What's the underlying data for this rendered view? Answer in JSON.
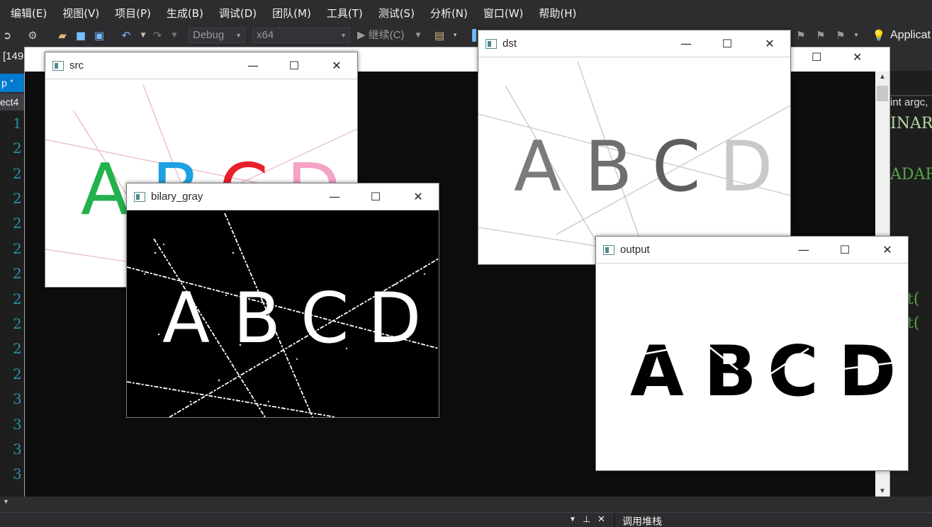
{
  "menu": [
    "编辑(E)",
    "视图(V)",
    "项目(P)",
    "生成(B)",
    "调试(D)",
    "团队(M)",
    "工具(T)",
    "测试(S)",
    "分析(N)",
    "窗口(W)",
    "帮助(H)"
  ],
  "toolbar": {
    "config": "Debug",
    "platform": "x64",
    "continue_label": "▶ 继续(C)",
    "app_label": "Applicat"
  },
  "left": {
    "tab_label": "[149",
    "side_tab1": "p ᐩ",
    "side_tab2": "ect4",
    "line_numbers": [
      "1",
      "2",
      "2",
      "2",
      "2",
      "2",
      "2",
      "2",
      "2",
      "2",
      "2",
      "3",
      "3",
      "3",
      "3"
    ]
  },
  "right_code": {
    "header": "int argc,",
    "line1": "INAR",
    "line2": "ADAP",
    "line3": "t(",
    "line4": "t("
  },
  "bottom": {
    "call_stack": "调用堆栈"
  },
  "windows": {
    "src": {
      "title": "src",
      "letters": [
        "A",
        "B",
        "C",
        "D"
      ],
      "colors": [
        "#22b14c",
        "#1da1e2",
        "#e8202a",
        "#f5a3c7"
      ]
    },
    "dst": {
      "title": "dst",
      "letters": [
        "A",
        "B",
        "C",
        "D"
      ],
      "colors": [
        "#7b7b7b",
        "#6e6e6e",
        "#5e5e5e",
        "#c9c9c9"
      ]
    },
    "bilary_gray": {
      "title": "bilary_gray",
      "letters": [
        "A",
        "B",
        "C",
        "D"
      ]
    },
    "output": {
      "title": "output",
      "letters": [
        "A",
        "B",
        "C",
        "D"
      ]
    }
  },
  "window_controls": {
    "minimize": "—",
    "maximize": "☐",
    "close": "✕"
  }
}
